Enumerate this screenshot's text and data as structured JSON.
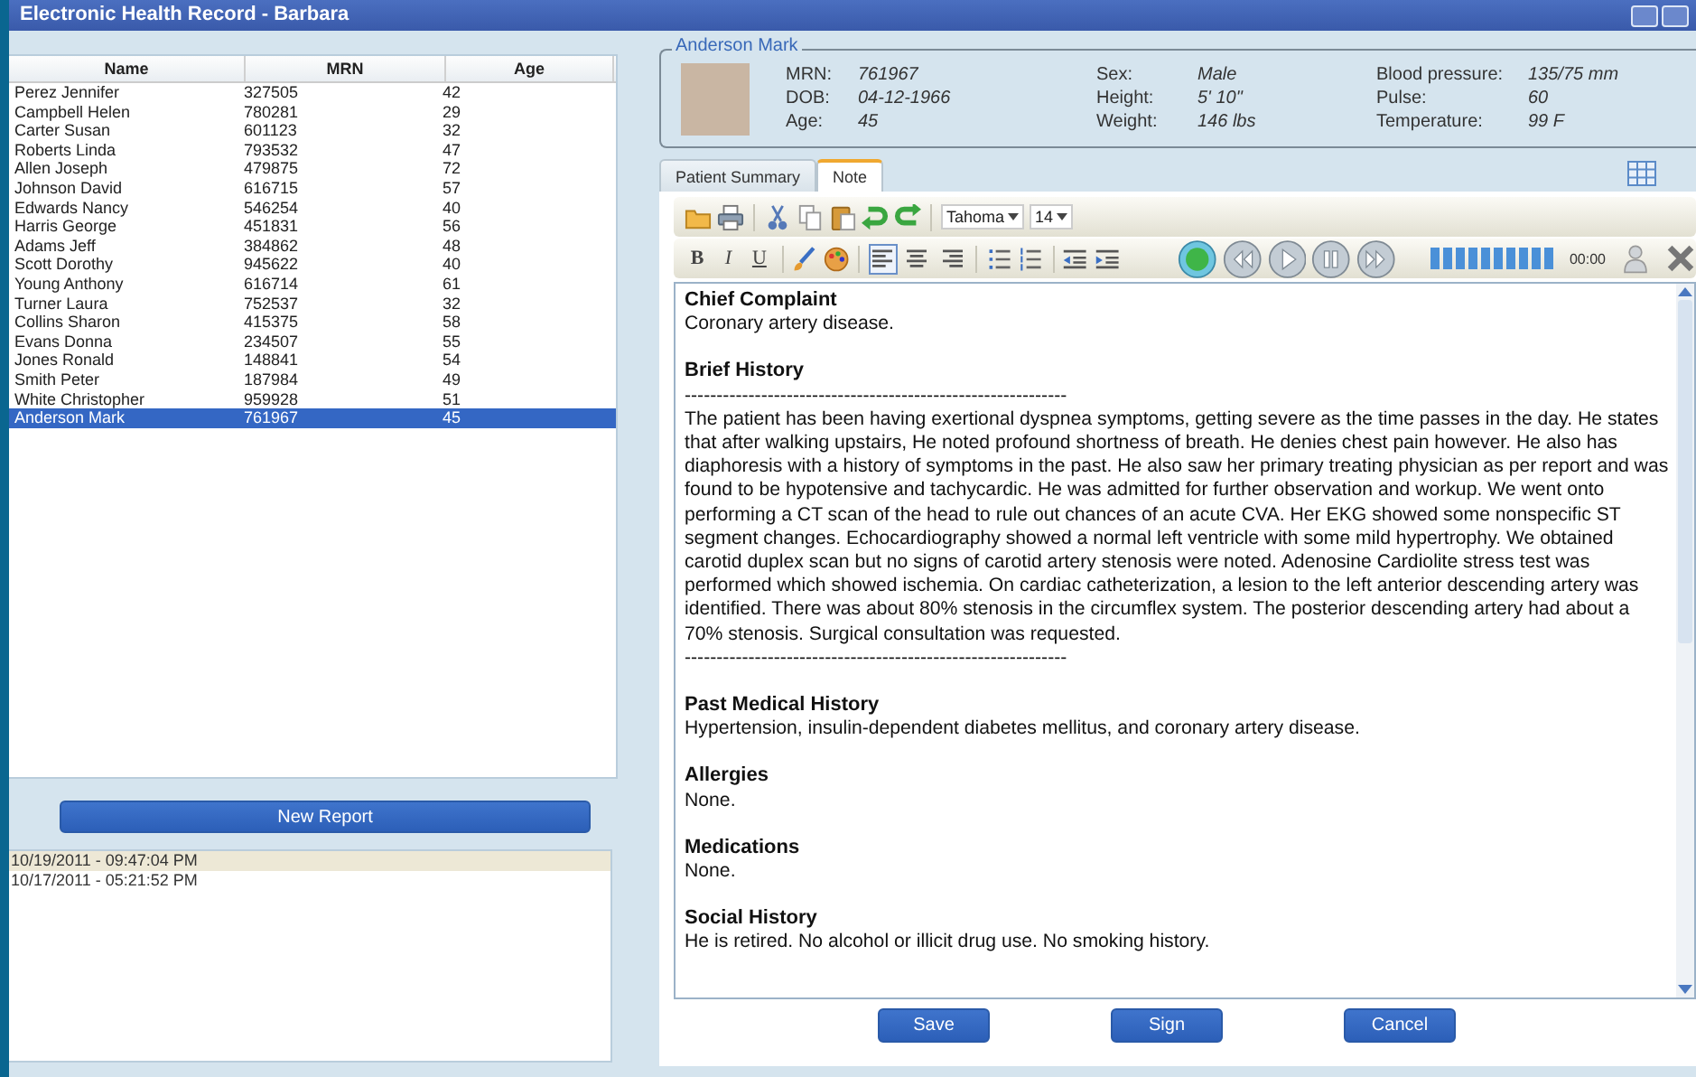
{
  "window": {
    "title": "Electronic Health Record - Barbara"
  },
  "patients": {
    "columns": [
      "Name",
      "MRN",
      "Age"
    ],
    "rows": [
      {
        "name": "Perez Jennifer",
        "mrn": "327505",
        "age": "42",
        "selected": false
      },
      {
        "name": "Campbell Helen",
        "mrn": "780281",
        "age": "29",
        "selected": false
      },
      {
        "name": "Carter Susan",
        "mrn": "601123",
        "age": "32",
        "selected": false
      },
      {
        "name": "Roberts Linda",
        "mrn": "793532",
        "age": "47",
        "selected": false
      },
      {
        "name": "Allen Joseph",
        "mrn": "479875",
        "age": "72",
        "selected": false
      },
      {
        "name": "Johnson David",
        "mrn": "616715",
        "age": "57",
        "selected": false
      },
      {
        "name": "Edwards Nancy",
        "mrn": "546254",
        "age": "40",
        "selected": false
      },
      {
        "name": "Harris George",
        "mrn": "451831",
        "age": "56",
        "selected": false
      },
      {
        "name": "Adams Jeff",
        "mrn": "384862",
        "age": "48",
        "selected": false
      },
      {
        "name": "Scott Dorothy",
        "mrn": "945622",
        "age": "40",
        "selected": false
      },
      {
        "name": "Young Anthony",
        "mrn": "616714",
        "age": "61",
        "selected": false
      },
      {
        "name": "Turner Laura",
        "mrn": "752537",
        "age": "32",
        "selected": false
      },
      {
        "name": "Collins Sharon",
        "mrn": "415375",
        "age": "58",
        "selected": false
      },
      {
        "name": "Evans Donna",
        "mrn": "234507",
        "age": "55",
        "selected": false
      },
      {
        "name": "Jones Ronald",
        "mrn": "148841",
        "age": "54",
        "selected": false
      },
      {
        "name": "Smith Peter",
        "mrn": "187984",
        "age": "49",
        "selected": false
      },
      {
        "name": "White Christopher",
        "mrn": "959928",
        "age": "51",
        "selected": false
      },
      {
        "name": "Anderson Mark",
        "mrn": "761967",
        "age": "45",
        "selected": true
      }
    ]
  },
  "new_report_button": "New Report",
  "reports": [
    {
      "text": "10/19/2011 - 09:47:04 PM",
      "selected": true
    },
    {
      "text": "10/17/2011 - 05:21:52 PM",
      "selected": false
    }
  ],
  "patient": {
    "name": "Anderson Mark",
    "columns": [
      [
        {
          "label": "MRN:",
          "value": "761967"
        },
        {
          "label": "DOB:",
          "value": "04-12-1966"
        },
        {
          "label": "Age:",
          "value": "45"
        }
      ],
      [
        {
          "label": "Sex:",
          "value": "Male"
        },
        {
          "label": "Height:",
          "value": "5' 10\""
        },
        {
          "label": "Weight:",
          "value": "146 lbs"
        }
      ],
      [
        {
          "label": "Blood pressure:",
          "value": "135/75 mm"
        },
        {
          "label": "Pulse:",
          "value": "60"
        },
        {
          "label": "Temperature:",
          "value": "99 F"
        }
      ]
    ]
  },
  "tabs": [
    {
      "label": "Patient Summary",
      "selected": false
    },
    {
      "label": "Note",
      "selected": true
    }
  ],
  "toolbar": {
    "font": "Tahoma",
    "size": "14",
    "format_buttons": [
      "B",
      "I",
      "U"
    ],
    "align_buttons": [
      {
        "selected": true
      },
      {
        "selected": false
      },
      {
        "selected": false
      }
    ],
    "recorder": {
      "level": 1,
      "time": "00:00"
    }
  },
  "note": [
    {
      "heading": "Chief Complaint",
      "body": [
        "Coronary artery disease."
      ]
    },
    {
      "heading": "Brief History",
      "body": [
        "------------------------------------------------------------",
        "The patient has been having exertional dyspnea symptoms, getting severe as the time passes in the day.  He states that after walking upstairs, He noted profound shortness of breath.  He denies chest pain however.  He also has diaphoresis with a history of symptoms in the past.  He also saw her primary treating physician as per report and was found to be hypotensive and tachycardic.  He was admitted for further observation and workup.  We went onto performing a CT scan of the head to rule out chances of an acute CVA.  Her EKG showed some nonspecific ST segment changes.  Echocardiography showed a normal left ventricle with some mild hypertrophy.  We obtained carotid duplex scan but no signs of carotid artery stenosis were noted.  Adenosine Cardiolite stress test was performed which showed ischemia.  On cardiac catheterization, a lesion to the left anterior descending artery was identified.  There was about 80% stenosis in the circumflex system.  The posterior descending artery had about a 70% stenosis.  Surgical consultation was requested.",
        "------------------------------------------------------------"
      ]
    },
    {
      "heading": "Past Medical History",
      "body": [
        "Hypertension, insulin-dependent diabetes mellitus, and coronary artery disease."
      ]
    },
    {
      "heading": "Allergies",
      "body": [
        "None."
      ]
    },
    {
      "heading": "Medications",
      "body": [
        "None."
      ]
    },
    {
      "heading": "Social History",
      "body": [
        "He is retired.  No alcohol or illicit drug use.  No smoking history."
      ]
    }
  ],
  "action_buttons": [
    "Save",
    "Sign",
    "Cancel"
  ]
}
